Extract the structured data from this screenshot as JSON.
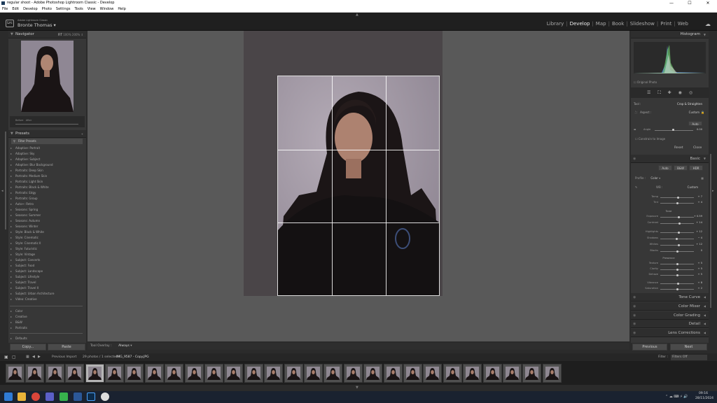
{
  "window": {
    "title": "regular shoot - Adobe Photoshop Lightroom Classic - Develop",
    "controls": [
      "—",
      "☐",
      "✕"
    ]
  },
  "menu": [
    "File",
    "Edit",
    "Develop",
    "Photo",
    "Settings",
    "Tools",
    "View",
    "Window",
    "Help"
  ],
  "identity": {
    "logo": "Lrc",
    "sub": "Adobe Lightroom Classic",
    "user": "Bronte Thomas"
  },
  "modules": [
    "Library",
    "Develop",
    "Map",
    "Book",
    "Slideshow",
    "Print",
    "Web"
  ],
  "navigator": {
    "title": "Navigator",
    "zoom": [
      "FIT",
      "100%",
      "200%"
    ]
  },
  "presets": {
    "title": "Presets",
    "filter": "Filter Presets",
    "items": [
      "Adaptive: Portrait",
      "Adaptive: Sky",
      "Adaptive: Subject",
      "Adaptive: Blur Background",
      "Portraits: Deep Skin",
      "Portraits: Medium Skin",
      "Portraits: Light Skin",
      "Portraits: Black & White",
      "Portraits: Edgy",
      "Portraits: Group",
      "Auto+: Retro",
      "Seasons: Spring",
      "Seasons: Summer",
      "Seasons: Autumn",
      "Seasons: Winter",
      "Style: Black & White",
      "Style: Cinematic",
      "Style: Cinematic II",
      "Style: Futuristic",
      "Style: Vintage",
      "Subject: Concerts",
      "Subject: Food",
      "Subject: Landscape",
      "Subject: Lifestyle",
      "Subject: Travel",
      "Subject: Travel II",
      "Subject: Urban Architecture",
      "Video: Creative"
    ],
    "items2": [
      "Color",
      "Creative",
      "B&W",
      "Portraits"
    ],
    "tail": "Defaults"
  },
  "left_buttons": {
    "copy": "Copy...",
    "paste": "Paste"
  },
  "toolbar": {
    "tool_overlay": "Tool Overlay :",
    "mode": "Always"
  },
  "histogram": {
    "title": "Histogram",
    "original": "Original Photo"
  },
  "crop": {
    "tool": "Tool :",
    "tool_name": "Crop & Straighten",
    "aspect_label": "Aspect :",
    "aspect_value": "Custom",
    "auto": "Auto",
    "angle_label": "Angle",
    "angle_value": "0.00",
    "constrain": "Constrain to Image",
    "reset": "Reset",
    "close": "Close"
  },
  "basic": {
    "title": "Basic",
    "modes": [
      "Auto",
      "B&W",
      "HDR"
    ],
    "profile_label": "Profile :",
    "profile_value": "Color",
    "wb_label": "WB :",
    "wb_value": "Custom",
    "temp": {
      "label": "Temp",
      "value": "+ 7"
    },
    "tint": {
      "label": "Tint",
      "value": "+ 4"
    },
    "tone_title": "Tone",
    "tone": [
      {
        "label": "Exposure",
        "value": "+ 0.59",
        "pos": 0.56
      },
      {
        "label": "Contrast",
        "value": "+ 14",
        "pos": 0.57
      },
      {
        "label": "Highlights",
        "value": "+ 12",
        "pos": 0.56
      },
      {
        "label": "Shadows",
        "value": "− 4",
        "pos": 0.48
      },
      {
        "label": "Whites",
        "value": "+ 12",
        "pos": 0.56
      },
      {
        "label": "Blacks",
        "value": "0",
        "pos": 0.5
      }
    ],
    "presence_title": "Presence",
    "presence": [
      {
        "label": "Texture",
        "value": "+ 5",
        "pos": 0.52
      },
      {
        "label": "Clarity",
        "value": "+ 5",
        "pos": 0.52
      },
      {
        "label": "Dehaze",
        "value": "+ 5",
        "pos": 0.52
      },
      {
        "label": "Vibrance",
        "value": "+ 8",
        "pos": 0.54
      },
      {
        "label": "Saturation",
        "value": "+ 2",
        "pos": 0.51
      }
    ]
  },
  "panels": [
    "Tone Curve",
    "Color Mixer",
    "Color Grading",
    "Detail",
    "Lens Corrections"
  ],
  "right_buttons": {
    "previous": "Previous",
    "next": "Next"
  },
  "filmstrip": {
    "source": "Previous Import",
    "info": "29 photos / 1 selected /",
    "file": "IMG_9587 - Copy.JPG",
    "filter_label": "Filter :",
    "filter_value": "Filters Off",
    "selected_index": 4
  },
  "taskbar": {
    "time": "09:16",
    "date": "28/11/2024"
  }
}
